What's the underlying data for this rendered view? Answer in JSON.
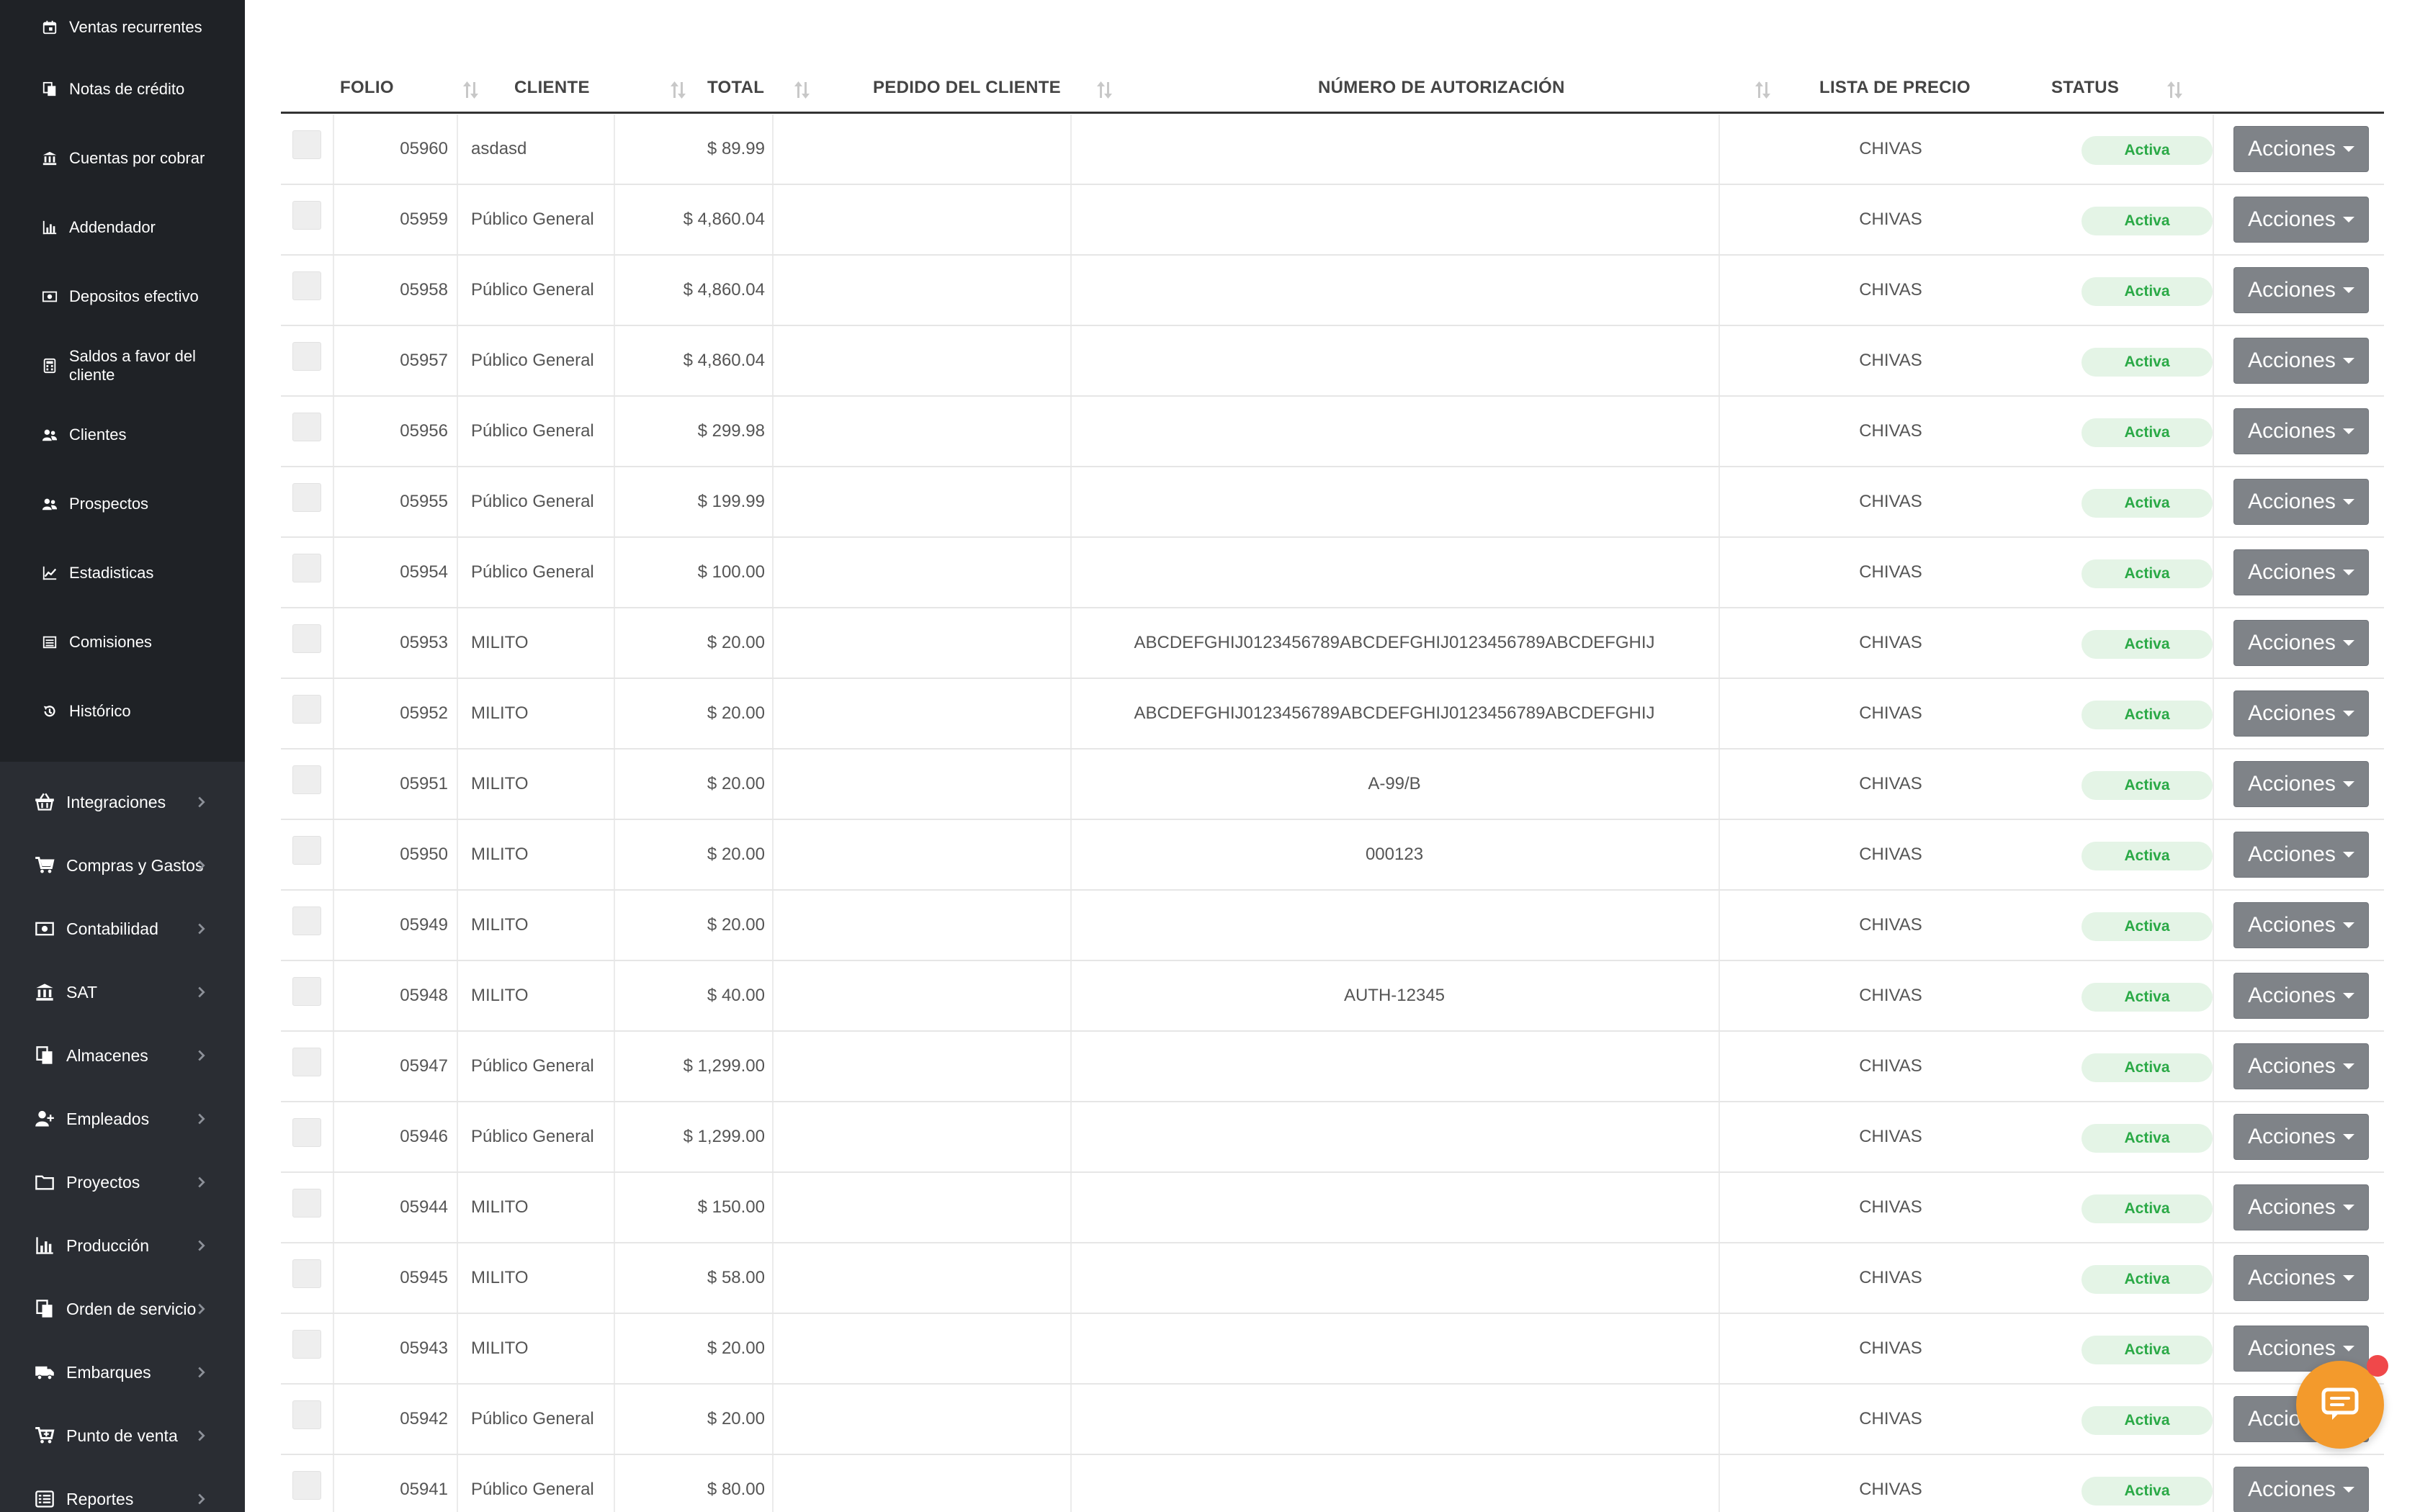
{
  "sidebar": {
    "sub_items": [
      {
        "label": "Ventas recurrentes",
        "icon": "calendar-icon"
      },
      {
        "label": "Notas de crédito",
        "icon": "copy-icon"
      },
      {
        "label": "Cuentas por cobrar",
        "icon": "bank-icon"
      },
      {
        "label": "Addendador",
        "icon": "bar-chart-icon"
      },
      {
        "label": "Depositos efectivo",
        "icon": "money-icon"
      },
      {
        "label": "Saldos a favor del cliente",
        "icon": "calculator-icon"
      },
      {
        "label": "Clientes",
        "icon": "users-icon"
      },
      {
        "label": "Prospectos",
        "icon": "users-icon"
      },
      {
        "label": "Estadisticas",
        "icon": "line-chart-icon"
      },
      {
        "label": "Comisiones",
        "icon": "list-icon"
      },
      {
        "label": "Histórico",
        "icon": "history-icon"
      }
    ],
    "main_items": [
      {
        "label": "Integraciones",
        "icon": "basket-icon"
      },
      {
        "label": "Compras y Gastos",
        "icon": "cart-icon"
      },
      {
        "label": "Contabilidad",
        "icon": "money-icon"
      },
      {
        "label": "SAT",
        "icon": "bank-icon"
      },
      {
        "label": "Almacenes",
        "icon": "copy-icon"
      },
      {
        "label": "Empleados",
        "icon": "user-plus-icon"
      },
      {
        "label": "Proyectos",
        "icon": "folder-icon"
      },
      {
        "label": "Producción",
        "icon": "bar-chart-icon"
      },
      {
        "label": "Orden de servicio",
        "icon": "copy-icon"
      },
      {
        "label": "Embarques",
        "icon": "truck-icon"
      },
      {
        "label": "Punto de venta",
        "icon": "cart-plus-icon"
      },
      {
        "label": "Reportes",
        "icon": "list-alt-icon"
      }
    ]
  },
  "table": {
    "headers": {
      "folio": "FOLIO",
      "cliente": "CLIENTE",
      "total": "TOTAL",
      "pedido": "PEDIDO DEL CLIENTE",
      "autorizacion": "NÚMERO DE AUTORIZACIÓN",
      "lista": "LISTA DE PRECIO",
      "status": "STATUS"
    },
    "rows": [
      {
        "folio": "05960",
        "cliente": "asdasd",
        "total": "$ 89.99",
        "pedido": "",
        "autorizacion": "",
        "lista": "CHIVAS",
        "status": "Activa",
        "accion": "Acciones"
      },
      {
        "folio": "05959",
        "cliente": "Público General",
        "total": "$ 4,860.04",
        "pedido": "",
        "autorizacion": "",
        "lista": "CHIVAS",
        "status": "Activa",
        "accion": "Acciones"
      },
      {
        "folio": "05958",
        "cliente": "Público General",
        "total": "$ 4,860.04",
        "pedido": "",
        "autorizacion": "",
        "lista": "CHIVAS",
        "status": "Activa",
        "accion": "Acciones"
      },
      {
        "folio": "05957",
        "cliente": "Público General",
        "total": "$ 4,860.04",
        "pedido": "",
        "autorizacion": "",
        "lista": "CHIVAS",
        "status": "Activa",
        "accion": "Acciones"
      },
      {
        "folio": "05956",
        "cliente": "Público General",
        "total": "$ 299.98",
        "pedido": "",
        "autorizacion": "",
        "lista": "CHIVAS",
        "status": "Activa",
        "accion": "Acciones"
      },
      {
        "folio": "05955",
        "cliente": "Público General",
        "total": "$ 199.99",
        "pedido": "",
        "autorizacion": "",
        "lista": "CHIVAS",
        "status": "Activa",
        "accion": "Acciones"
      },
      {
        "folio": "05954",
        "cliente": "Público General",
        "total": "$ 100.00",
        "pedido": "",
        "autorizacion": "",
        "lista": "CHIVAS",
        "status": "Activa",
        "accion": "Acciones"
      },
      {
        "folio": "05953",
        "cliente": "MILITO",
        "total": "$ 20.00",
        "pedido": "",
        "autorizacion": "ABCDEFGHIJ0123456789ABCDEFGHIJ0123456789ABCDEFGHIJ",
        "lista": "CHIVAS",
        "status": "Activa",
        "accion": "Acciones"
      },
      {
        "folio": "05952",
        "cliente": "MILITO",
        "total": "$ 20.00",
        "pedido": "",
        "autorizacion": "ABCDEFGHIJ0123456789ABCDEFGHIJ0123456789ABCDEFGHIJ",
        "lista": "CHIVAS",
        "status": "Activa",
        "accion": "Acciones"
      },
      {
        "folio": "05951",
        "cliente": "MILITO",
        "total": "$ 20.00",
        "pedido": "",
        "autorizacion": "A-99/B",
        "lista": "CHIVAS",
        "status": "Activa",
        "accion": "Acciones"
      },
      {
        "folio": "05950",
        "cliente": "MILITO",
        "total": "$ 20.00",
        "pedido": "",
        "autorizacion": "000123",
        "lista": "CHIVAS",
        "status": "Activa",
        "accion": "Acciones"
      },
      {
        "folio": "05949",
        "cliente": "MILITO",
        "total": "$ 20.00",
        "pedido": "",
        "autorizacion": "",
        "lista": "CHIVAS",
        "status": "Activa",
        "accion": "Acciones"
      },
      {
        "folio": "05948",
        "cliente": "MILITO",
        "total": "$ 40.00",
        "pedido": "",
        "autorizacion": "AUTH-12345",
        "lista": "CHIVAS",
        "status": "Activa",
        "accion": "Acciones"
      },
      {
        "folio": "05947",
        "cliente": "Público General",
        "total": "$ 1,299.00",
        "pedido": "",
        "autorizacion": "",
        "lista": "CHIVAS",
        "status": "Activa",
        "accion": "Acciones"
      },
      {
        "folio": "05946",
        "cliente": "Público General",
        "total": "$ 1,299.00",
        "pedido": "",
        "autorizacion": "",
        "lista": "CHIVAS",
        "status": "Activa",
        "accion": "Acciones"
      },
      {
        "folio": "05944",
        "cliente": "MILITO",
        "total": "$ 150.00",
        "pedido": "",
        "autorizacion": "",
        "lista": "CHIVAS",
        "status": "Activa",
        "accion": "Acciones"
      },
      {
        "folio": "05945",
        "cliente": "MILITO",
        "total": "$ 58.00",
        "pedido": "",
        "autorizacion": "",
        "lista": "CHIVAS",
        "status": "Activa",
        "accion": "Acciones"
      },
      {
        "folio": "05943",
        "cliente": "MILITO",
        "total": "$ 20.00",
        "pedido": "",
        "autorizacion": "",
        "lista": "CHIVAS",
        "status": "Activa",
        "accion": "Acciones"
      },
      {
        "folio": "05942",
        "cliente": "Público General",
        "total": "$ 20.00",
        "pedido": "",
        "autorizacion": "",
        "lista": "CHIVAS",
        "status": "Activa",
        "accion": "Acciones"
      },
      {
        "folio": "05941",
        "cliente": "Público General",
        "total": "$ 80.00",
        "pedido": "",
        "autorizacion": "",
        "lista": "CHIVAS",
        "status": "Activa",
        "accion": "Acciones"
      }
    ]
  },
  "chat": {
    "icon": "chat-icon"
  },
  "colors": {
    "sidebar_bg": "#2a2d33",
    "submenu_bg": "#1f2226",
    "badge_bg": "#e4f4e6",
    "badge_text": "#2aa946",
    "action_button": "#7f8388",
    "chat_orange": "#f39a2c",
    "notification_red": "#f0484a"
  }
}
